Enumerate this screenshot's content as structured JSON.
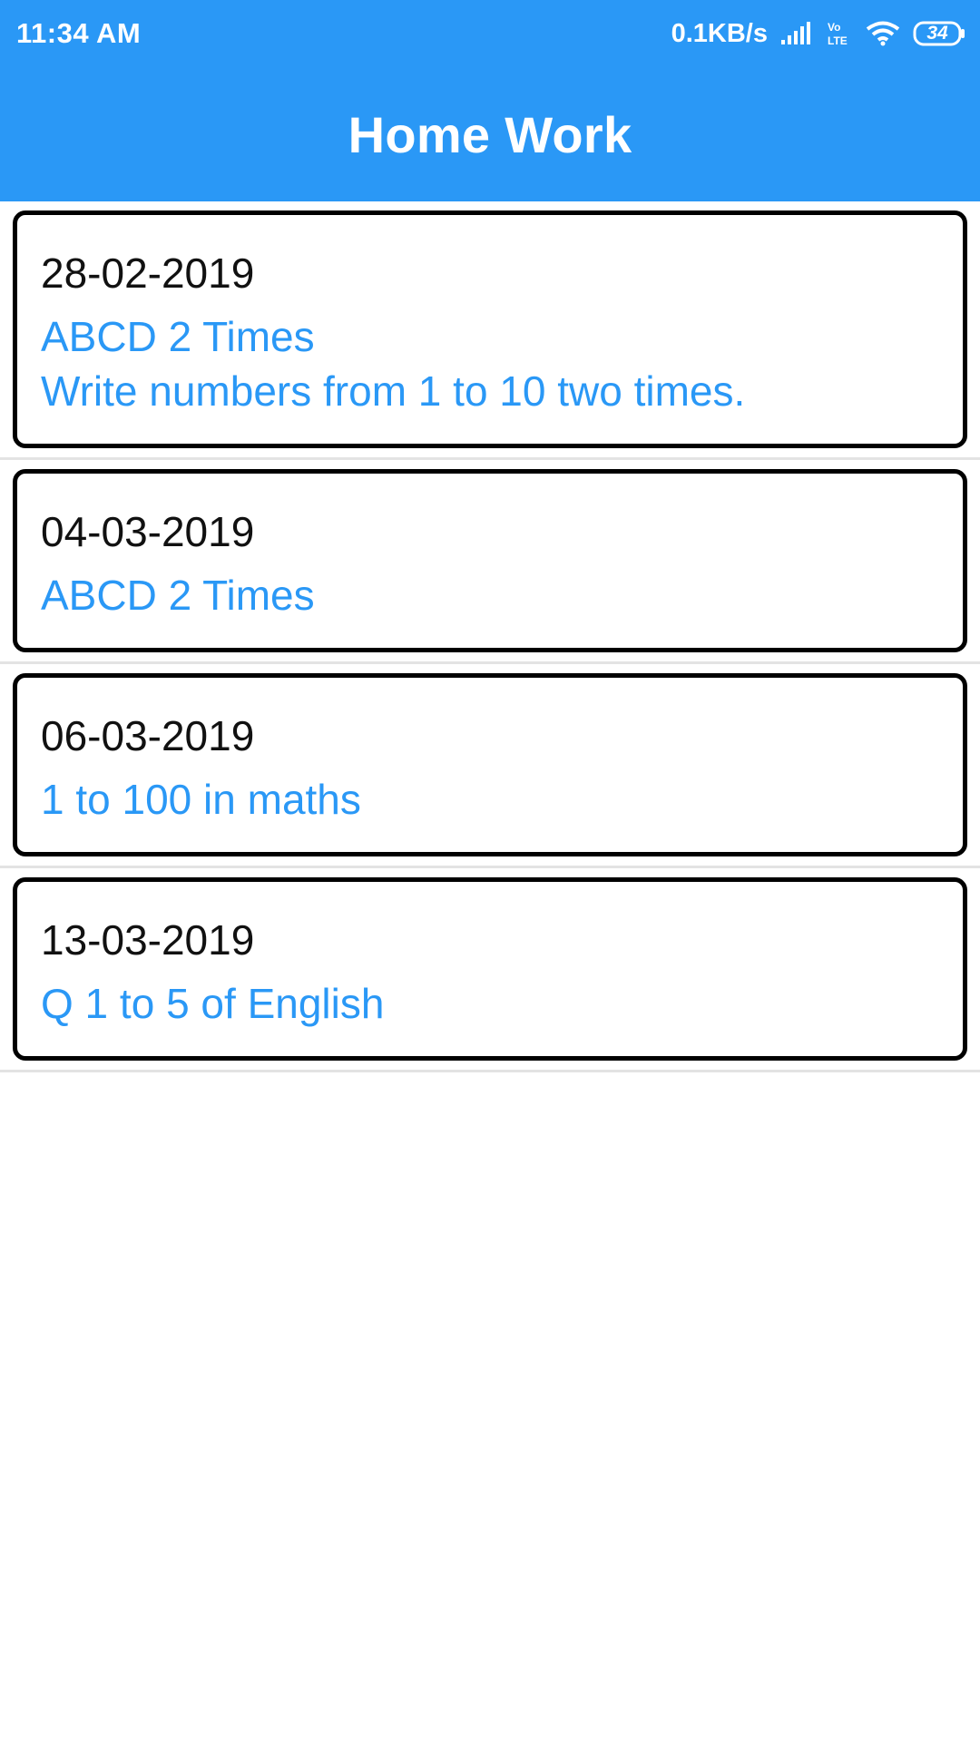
{
  "status_bar": {
    "time": "11:34 AM",
    "network_speed": "0.1KB/s",
    "signal_icon": "cellular-signal-icon",
    "volte_label": "Vo LTE",
    "wifi_icon": "wifi-icon",
    "battery_level": "34"
  },
  "app_bar": {
    "title": "Home Work"
  },
  "homework": [
    {
      "date": "28-02-2019",
      "title": "ABCD 2 Times",
      "description": "Write numbers from 1 to 10 two times."
    },
    {
      "date": "04-03-2019",
      "title": "ABCD 2 Times",
      "description": ""
    },
    {
      "date": "06-03-2019",
      "title": "1 to 100 in maths",
      "description": ""
    },
    {
      "date": "13-03-2019",
      "title": "Q 1 to 5 of English",
      "description": ""
    }
  ],
  "colors": {
    "primary": "#2a98f6",
    "card_border": "#000000",
    "divider": "#e3e3e3"
  }
}
